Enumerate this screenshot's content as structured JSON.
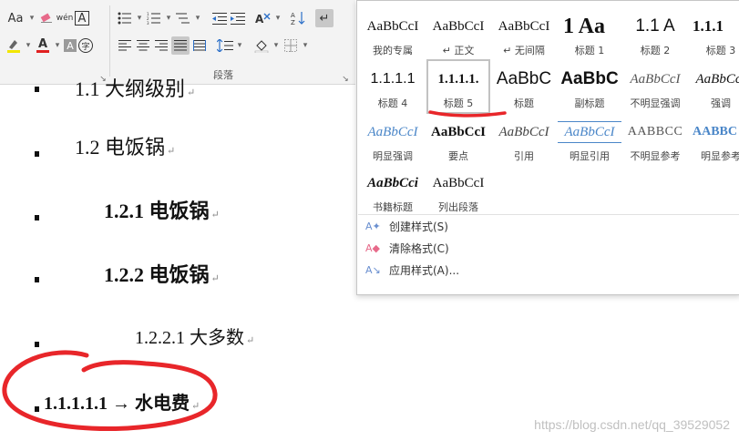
{
  "ribbon": {
    "group_label": "段落",
    "font_size_label": "Aa",
    "phonetic_label": "wén",
    "boxed_char": "A",
    "enclosed_char": "字",
    "shade_char": "A",
    "icons": {
      "font_case": "font-case-icon",
      "clear_format": "eraser-icon",
      "phonetic": "phonetic-guide-icon",
      "char_border": "character-border-icon",
      "enclosed": "enclosed-character-icon",
      "bullets": "bullets-icon",
      "numbering": "numbering-icon",
      "multilevel": "multilevel-list-icon",
      "decrease_indent": "decrease-indent-icon",
      "increase_indent": "increase-indent-icon",
      "asian_layout": "asian-layout-icon",
      "sort": "sort-icon",
      "show_marks": "show-marks-icon",
      "highlight": "highlight-icon",
      "font_color": "font-color-icon",
      "char_shading": "character-shading-icon",
      "align_left": "align-left-icon",
      "align_center": "align-center-icon",
      "align_right": "align-right-icon",
      "justify": "justify-icon",
      "distribute": "distributed-icon",
      "line_spacing": "line-spacing-icon",
      "shading": "shading-icon",
      "borders": "borders-icon"
    }
  },
  "document": {
    "lines": [
      {
        "text": "1.1 大纲级别",
        "style": "h2"
      },
      {
        "text": "1.2 电饭锅",
        "style": "h2"
      },
      {
        "text": "1.2.1  电饭锅",
        "style": "h3"
      },
      {
        "text": "1.2.2  电饭锅",
        "style": "h3"
      },
      {
        "text": "1.2.2.1 大多数",
        "style": "h4"
      },
      {
        "text": "1.1.1.1.1 → 水电费",
        "style": "h5"
      }
    ],
    "paragraph_mark": "↵",
    "watermark": "https://blog.csdn.net/qq_39529052"
  },
  "styles_gallery": {
    "tiles": [
      {
        "preview": "AaBbCcI",
        "name": "我的专属"
      },
      {
        "preview": "AaBbCcI",
        "name": "↵ 正文"
      },
      {
        "preview": "AaBbCcI",
        "name": "↵ 无间隔"
      },
      {
        "preview": "1 Aa",
        "name": "标题 1"
      },
      {
        "preview": "1.1 A",
        "name": "标题 2"
      },
      {
        "preview": "1.1.1",
        "name": "标题 3"
      },
      {
        "preview": "1.1.1.1",
        "name": "标题 4"
      },
      {
        "preview": "1.1.1.1.",
        "name": "标题 5"
      },
      {
        "preview": "AaBbC",
        "name": "标题"
      },
      {
        "preview": "AaBbC",
        "name": "副标题"
      },
      {
        "preview": "AaBbCcI",
        "name": "不明显强调"
      },
      {
        "preview": "AaBbCcI",
        "name": "强调"
      },
      {
        "preview": "AaBbCcI",
        "name": "明显强调"
      },
      {
        "preview": "AaBbCcI",
        "name": "要点"
      },
      {
        "preview": "AaBbCcI",
        "name": "引用"
      },
      {
        "preview": "AaBbCcI",
        "name": "明显引用"
      },
      {
        "preview": "AABBCC",
        "name": "不明显参考"
      },
      {
        "preview": "AABBC",
        "name": "明显参考"
      },
      {
        "preview": "AaBbCci",
        "name": "书籍标题"
      },
      {
        "preview": "AaBbCcI",
        "name": "列出段落"
      }
    ],
    "active_tile": "标题 5",
    "menu": [
      {
        "label": "创建样式(S)",
        "icon": "create-style-icon"
      },
      {
        "label": "清除格式(C)",
        "icon": "clear-format-icon"
      },
      {
        "label": "应用样式(A)...",
        "icon": "apply-style-icon"
      }
    ]
  },
  "annotations": {
    "color": "#e8262a",
    "items": [
      "underline-title5",
      "circle-doc-heading5"
    ]
  },
  "colors": {
    "ribbon_bg": "#f3f3f3",
    "highlight": "#f2e600",
    "font_color": "#e02020",
    "link_blue": "#4a86c8"
  }
}
